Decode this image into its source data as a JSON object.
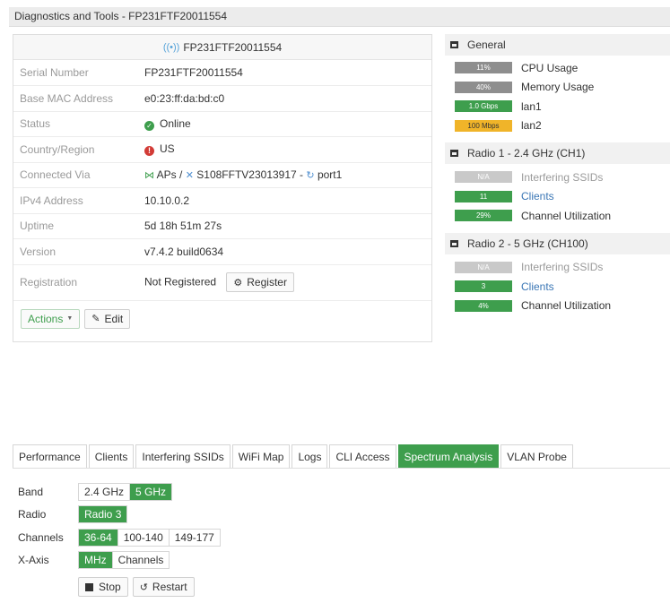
{
  "page": {
    "title": "Diagnostics and Tools - FP231FTF20011554"
  },
  "device": {
    "header": "FP231FTF20011554",
    "rows": {
      "serial": {
        "label": "Serial Number",
        "value": "FP231FTF20011554"
      },
      "mac": {
        "label": "Base MAC Address",
        "value": "e0:23:ff:da:bd:c0"
      },
      "status": {
        "label": "Status",
        "value": "Online"
      },
      "country": {
        "label": "Country/Region",
        "value": "US"
      },
      "connected": {
        "label": "Connected Via",
        "aps": "APs",
        "sep1": "/",
        "switch": "S108FFTV23013917",
        "sep2": "-",
        "port": "port1"
      },
      "ipv4": {
        "label": "IPv4 Address",
        "value": "10.10.0.2"
      },
      "uptime": {
        "label": "Uptime",
        "value": "5d 18h 51m 27s"
      },
      "version": {
        "label": "Version",
        "value": "v7.4.2 build0634"
      },
      "registration": {
        "label": "Registration",
        "value": "Not Registered",
        "button": "Register"
      }
    },
    "actions": {
      "actions_label": "Actions",
      "edit_label": "Edit"
    }
  },
  "general": {
    "title": "General",
    "metrics": [
      {
        "bar": "11%",
        "label": "CPU Usage"
      },
      {
        "bar": "40%",
        "label": "Memory Usage"
      },
      {
        "bar": "1.0 Gbps",
        "label": "lan1"
      },
      {
        "bar": "100 Mbps",
        "label": "lan2"
      }
    ]
  },
  "radio1": {
    "title": "Radio 1 - 2.4 GHz (CH1)",
    "metrics": [
      {
        "bar": "N/A",
        "label": "Interfering SSIDs"
      },
      {
        "bar": "11",
        "label": "Clients"
      },
      {
        "bar": "29%",
        "label": "Channel Utilization"
      }
    ]
  },
  "radio2": {
    "title": "Radio 2 - 5 GHz (CH100)",
    "metrics": [
      {
        "bar": "N/A",
        "label": "Interfering SSIDs"
      },
      {
        "bar": "3",
        "label": "Clients"
      },
      {
        "bar": "4%",
        "label": "Channel Utilization"
      }
    ]
  },
  "tabs": [
    "Performance",
    "Clients",
    "Interfering SSIDs",
    "WiFi Map",
    "Logs",
    "CLI Access",
    "Spectrum Analysis",
    "VLAN Probe"
  ],
  "active_tab": "Spectrum Analysis",
  "spectrum": {
    "band": {
      "label": "Band",
      "options": [
        "2.4 GHz",
        "5 GHz"
      ],
      "selected": "5 GHz"
    },
    "radio": {
      "label": "Radio",
      "options": [
        "Radio 3"
      ],
      "selected": "Radio 3"
    },
    "channels": {
      "label": "Channels",
      "options": [
        "36-64",
        "100-140",
        "149-177"
      ],
      "selected": "36-64"
    },
    "xaxis": {
      "label": "X-Axis",
      "options": [
        "MHz",
        "Channels"
      ],
      "selected": "MHz"
    },
    "stop_label": "Stop",
    "restart_label": "Restart"
  },
  "colors": {
    "accent": "#3e9e4d",
    "warning": "#f0b429",
    "error": "#d23b36",
    "link": "#3a76b5"
  }
}
